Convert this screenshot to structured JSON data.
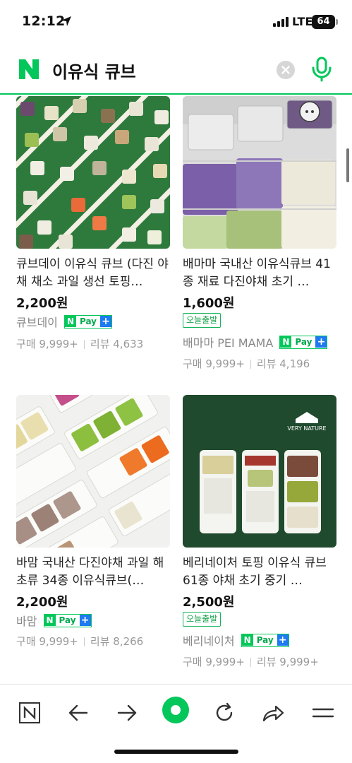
{
  "status_bar": {
    "time": "12:12",
    "network": "LTE",
    "battery": "64"
  },
  "search": {
    "query": "이유식 큐브"
  },
  "colors": {
    "brand_green": "#03c75a",
    "npay_blue": "#1d7af0"
  },
  "products": [
    {
      "title": "큐브데이 이유식 큐브 (다진 야채 채소 과일 생선 토핑…",
      "price": "2,200원",
      "badge": "",
      "seller": "큐브데이",
      "npay": true,
      "purchase": "구매 9,999+",
      "reviews": "리뷰 4,633"
    },
    {
      "title": "배마마 국내산 이유식큐브 41종 재료 다진야채 초기 …",
      "price": "1,600원",
      "badge": "오늘출발",
      "seller": "배마마 PEI MAMA",
      "npay": true,
      "purchase": "구매 9,999+",
      "reviews": "리뷰 4,196"
    },
    {
      "title": "바맘 국내산 다진야채 과일 해초류 34종 이유식큐브(…",
      "price": "2,200원",
      "badge": "",
      "seller": "바맘",
      "npay": true,
      "purchase": "구매 9,999+",
      "reviews": "리뷰 8,266"
    },
    {
      "title": "베리네이처 토핑 이유식 큐브 61종 야채 초기 중기 …",
      "price": "2,500원",
      "badge": "오늘출발",
      "seller": "베리네이처",
      "npay": true,
      "purchase": "구매 9,999+",
      "reviews": "리뷰 9,999+"
    }
  ],
  "npay_label": {
    "n": "N",
    "pay": "Pay",
    "plus": "+"
  },
  "image_text": {
    "very_nature_logo": "VERY NATURE"
  },
  "toolbar": {
    "icons": [
      "naver-home-icon",
      "back-arrow-icon",
      "forward-arrow-icon",
      "green-dot-icon",
      "refresh-icon",
      "share-icon",
      "menu-icon"
    ]
  }
}
